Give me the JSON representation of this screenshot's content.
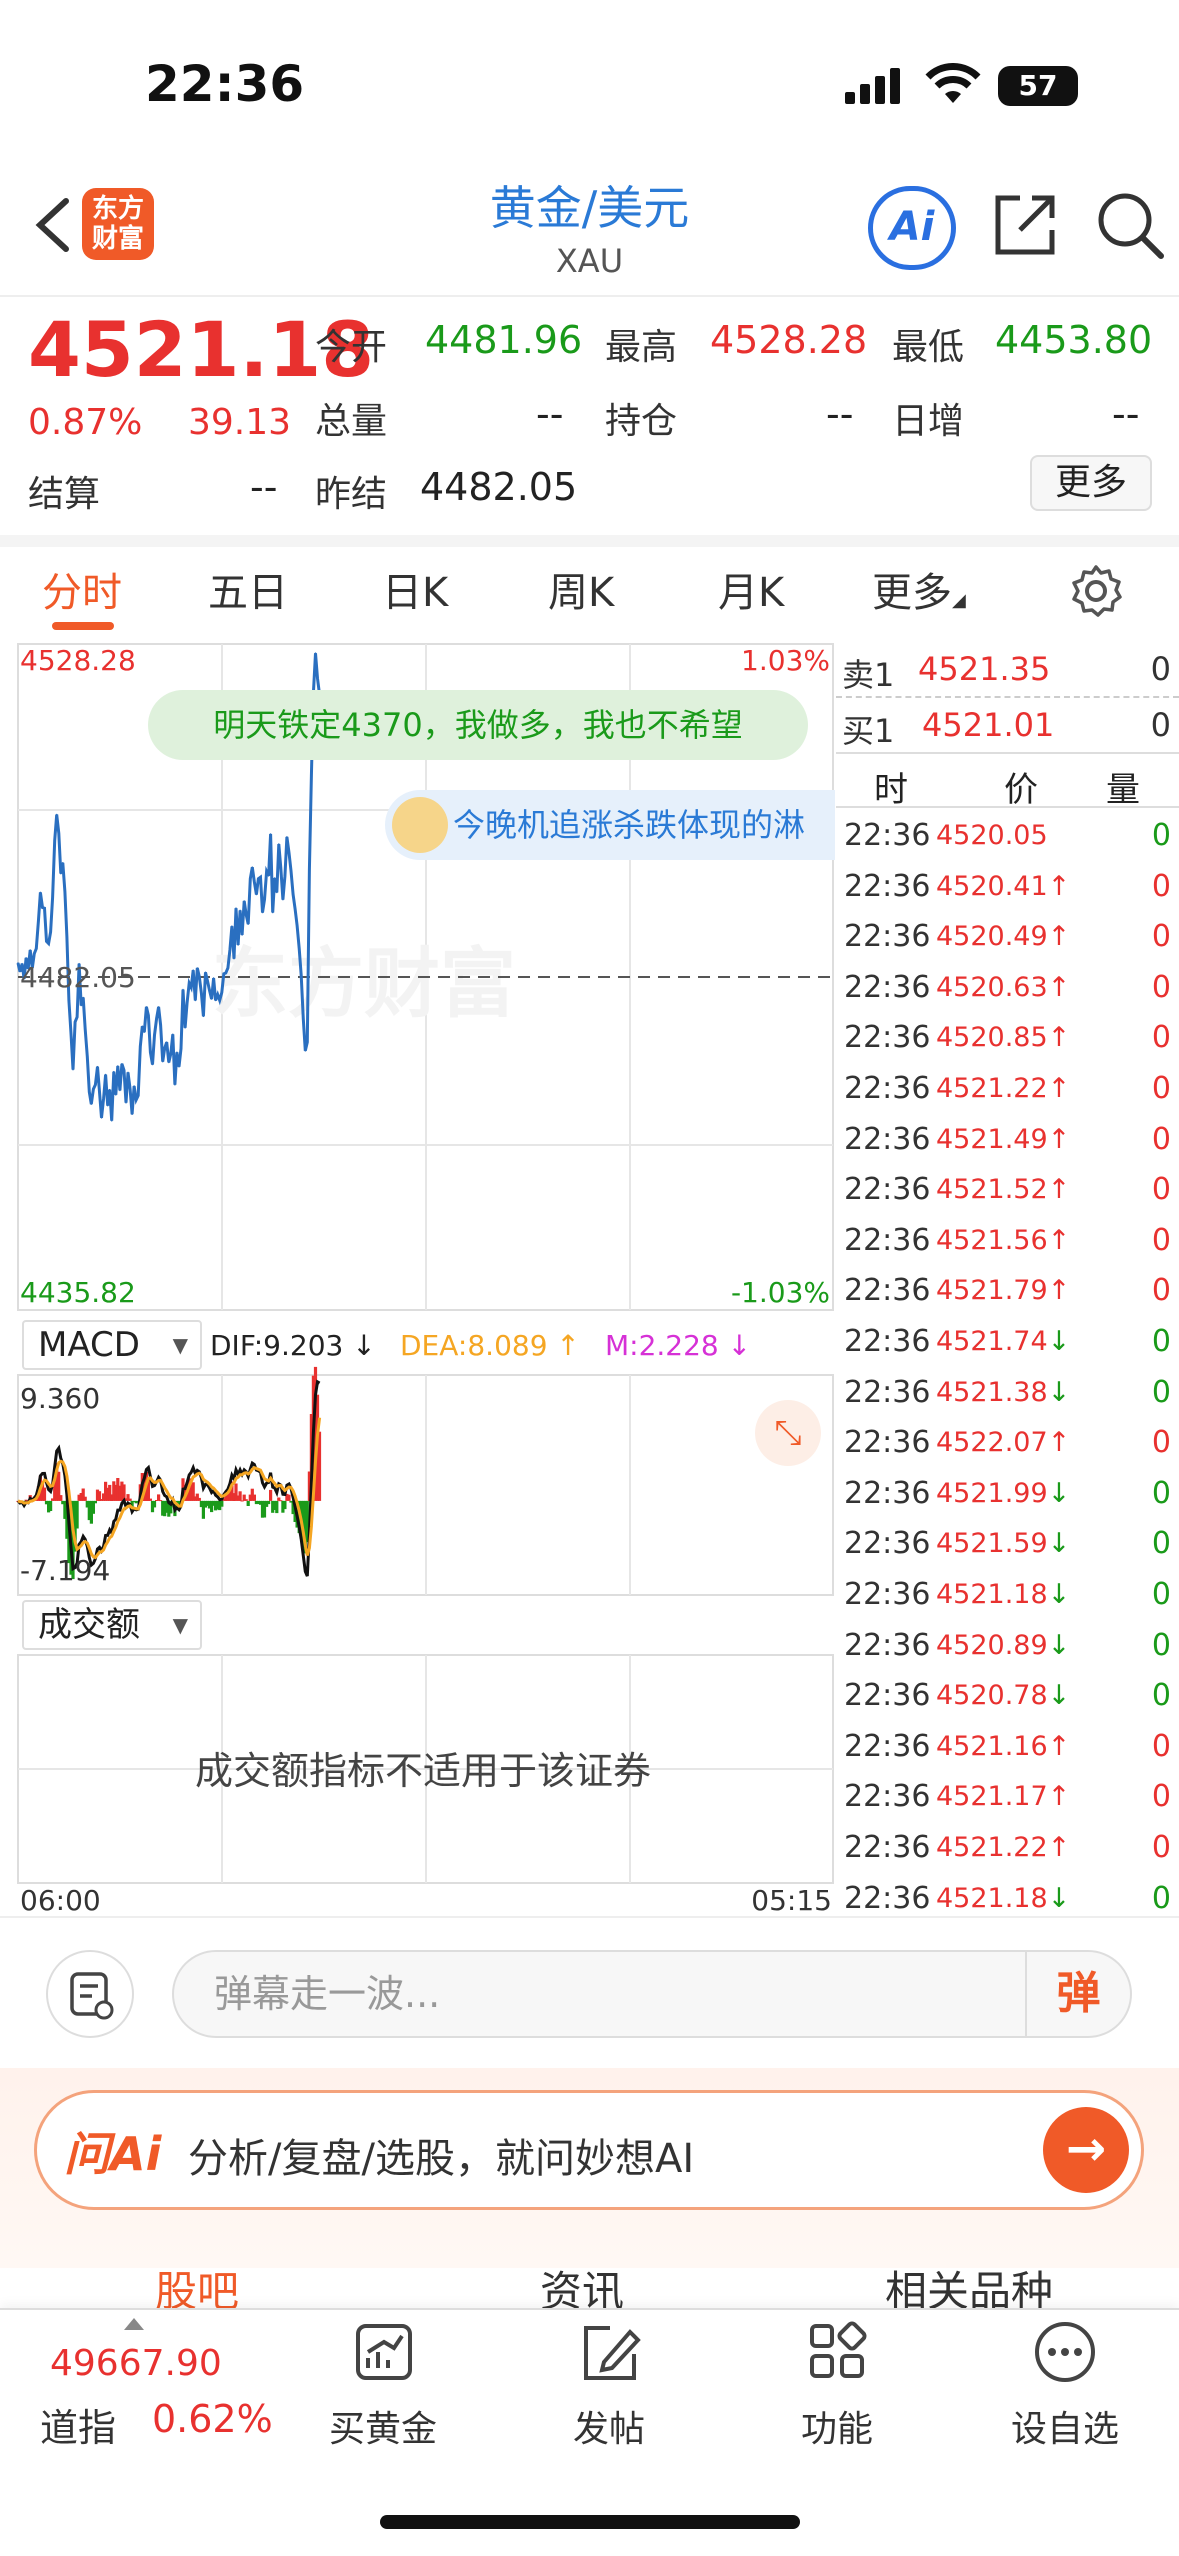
{
  "status_bar": {
    "time": "22:36",
    "battery": "57"
  },
  "header": {
    "logo_text_line1": "东方",
    "logo_text_line2": "财富",
    "title": "黄金/美元",
    "subtitle": "XAU",
    "ai_label": "Ai",
    "icons": [
      "back-icon",
      "share-icon",
      "search-icon"
    ]
  },
  "quote": {
    "price": "4521.18",
    "pct_change": "0.87%",
    "change": "39.13",
    "open_label": "今开",
    "open": "4481.96",
    "high_label": "最高",
    "high": "4528.28",
    "low_label": "最低",
    "low": "4453.80",
    "volume_label": "总量",
    "volume": "--",
    "oi_label": "持仓",
    "oi": "--",
    "daily_inc_label": "日增",
    "daily_inc": "--",
    "settle_label": "结算",
    "settle": "--",
    "prev_settle_label": "昨结",
    "prev_settle": "4482.05",
    "more_button": "更多"
  },
  "tabs": [
    "分时",
    "五日",
    "日K",
    "周K",
    "月K",
    "更多"
  ],
  "colors": {
    "accent": "#f05a28",
    "up": "#e8312f",
    "down": "#1a9a1a",
    "line": "#2a6fc0",
    "dea": "#f5a623",
    "m": "#d631d6"
  },
  "chart_data": [
    {
      "type": "line",
      "title": "",
      "y_top_label": "4528.28",
      "y_mid_label": "4482.05",
      "y_bottom_label": "4435.82",
      "pct_top_label": "1.03%",
      "pct_bottom_label": "-1.03%",
      "x_start_label": "06:00",
      "x_end_label": "05:15",
      "ylim": [
        4435.82,
        4528.28
      ],
      "reference": 4482.05,
      "x": [
        0,
        2,
        4,
        6,
        8,
        10,
        12,
        14,
        16,
        18,
        20,
        22,
        24,
        26,
        28,
        30,
        32,
        34,
        36,
        38,
        40,
        42,
        44,
        46,
        48,
        50,
        52,
        54,
        56,
        58,
        60,
        62,
        64,
        66,
        68,
        70,
        72,
        74,
        76,
        78,
        80,
        82,
        84,
        86,
        88,
        90,
        92,
        94,
        96,
        98,
        100,
        102,
        104,
        106,
        108,
        110,
        112,
        114,
        116,
        118,
        120,
        122,
        124,
        126,
        128,
        130,
        132,
        134,
        136,
        138,
        140,
        142,
        144,
        146,
        148,
        150,
        152,
        154,
        156,
        158,
        160,
        162,
        164,
        166,
        168,
        170,
        172,
        174,
        176,
        178,
        180,
        182,
        184,
        186,
        188,
        190,
        192,
        194,
        196,
        198,
        200,
        202,
        204,
        206,
        208,
        210,
        212,
        214,
        216,
        218,
        220,
        222,
        224,
        226,
        228,
        230,
        232,
        234,
        236,
        238,
        240,
        242,
        244,
        246,
        248,
        250,
        252,
        254,
        256,
        258,
        260,
        262,
        264,
        266,
        268,
        270,
        272,
        274,
        276,
        278,
        280,
        282,
        284,
        286,
        288,
        290,
        292,
        294,
        296,
        298,
        300,
        302,
        304,
        306,
        308,
        310,
        312,
        314,
        316,
        318,
        320,
        322,
        324,
        326,
        328,
        330,
        332,
        334,
        336,
        338,
        340,
        342,
        344,
        346,
        348,
        350,
        352,
        354,
        356,
        358,
        360,
        362,
        364,
        366,
        368,
        370,
        372,
        374,
        376,
        378,
        380,
        382,
        384,
        386
      ],
      "series": [
        {
          "values": [
            4484.0,
            4482.8,
            4483.9,
            4481.8,
            4484.7,
            4483.2,
            4485.8,
            4483.3,
            4485.3,
            4486.0,
            4489.8,
            4493.8,
            4491.7,
            4491.6,
            4487.0,
            4486.7,
            4488.3,
            4493.1,
            4501.0,
            4504.6,
            4502.0,
            4496.4,
            4497.9,
            4493.9,
            4487.6,
            4478.8,
            4474.2,
            4469.2,
            4475.8,
            4476.5,
            4483.9,
            4478.1,
            4479.2,
            4474.8,
            4471.0,
            4466.1,
            4464.4,
            4466.5,
            4467.1,
            4469.6,
            4466.1,
            4462.5,
            4465.2,
            4468.5,
            4464.2,
            4466.4,
            4462.1,
            4468.9,
            4465.7,
            4469.7,
            4466.3,
            4470.0,
            4469.1,
            4464.6,
            4468.8,
            4466.5,
            4463.0,
            4466.9,
            4465.0,
            4465.6,
            4472.4,
            4475.2,
            4474.4,
            4477.9,
            4476.7,
            4471.6,
            4469.9,
            4474.0,
            4476.3,
            4477.9,
            4475.4,
            4470.3,
            4472.2,
            4473.0,
            4470.2,
            4471.4,
            4474.1,
            4467.1,
            4471.6,
            4469.6,
            4472.1,
            4480.3,
            4475.0,
            4478.5,
            4481.2,
            4480.6,
            4483.0,
            4478.8,
            4483.3,
            4482.1,
            4479.8,
            4476.6,
            4482.7,
            4481.5,
            4480.2,
            4479.0,
            4481.9,
            4478.8,
            4479.6,
            4478.8,
            4479.9,
            4482.5,
            4482.6,
            4483.3,
            4485.8,
            4489.1,
            4484.6,
            4491.6,
            4486.5,
            4491.3,
            4487.9,
            4492.6,
            4490.7,
            4489.4,
            4495.7,
            4497.3,
            4495.3,
            4493.5,
            4495.7,
            4495.9,
            4491.0,
            4492.8,
            4496.7,
            4496.1,
            4501.9,
            4491.0,
            4495.8,
            4493.8,
            4500.5,
            4497.2,
            4492.8,
            4496.0,
            4501.5,
            4499.3,
            4496.8,
            4493.5,
            4491.5,
            4489.2,
            4486.0,
            4482.3,
            4476.2,
            4471.8,
            4473.0,
            4497.0,
            4510.0,
            4521.5,
            4527.0,
            4523.5,
            4521.2
          ]
        }
      ]
    },
    {
      "type": "bar",
      "title": "",
      "indicator": "MACD",
      "dif_label": "DIF:9.203 ↓",
      "dea_label": "DEA:8.089 ↑",
      "m_label": "M:2.228 ↓",
      "y_top_label": "9.360",
      "y_bottom_label": "-7.194",
      "ylim": [
        -7.194,
        9.36
      ]
    }
  ],
  "indicator_selectors": {
    "macd": "MACD",
    "volume": "成交额"
  },
  "volume_message": "成交额指标不适用于该证券",
  "danmaku": [
    {
      "text": "明天铁定4370，我做多，我也不希望"
    },
    {
      "text": "今晚机追涨杀跌体现的淋"
    }
  ],
  "order_book": [
    {
      "label": "卖1",
      "price": "4521.35",
      "qty": "0"
    },
    {
      "label": "买1",
      "price": "4521.01",
      "qty": "0"
    }
  ],
  "ticks_header": {
    "time": "时",
    "price": "价",
    "qty": "量"
  },
  "ticks": [
    {
      "time": "22:36",
      "price": "4520.05",
      "dir": "",
      "qty": "0",
      "color": "up",
      "qcolor": "down"
    },
    {
      "time": "22:36",
      "price": "4520.41",
      "dir": "↑",
      "qty": "0",
      "color": "up",
      "qcolor": "up"
    },
    {
      "time": "22:36",
      "price": "4520.49",
      "dir": "↑",
      "qty": "0",
      "color": "up",
      "qcolor": "up"
    },
    {
      "time": "22:36",
      "price": "4520.63",
      "dir": "↑",
      "qty": "0",
      "color": "up",
      "qcolor": "up"
    },
    {
      "time": "22:36",
      "price": "4520.85",
      "dir": "↑",
      "qty": "0",
      "color": "up",
      "qcolor": "up"
    },
    {
      "time": "22:36",
      "price": "4521.22",
      "dir": "↑",
      "qty": "0",
      "color": "up",
      "qcolor": "up"
    },
    {
      "time": "22:36",
      "price": "4521.49",
      "dir": "↑",
      "qty": "0",
      "color": "up",
      "qcolor": "up"
    },
    {
      "time": "22:36",
      "price": "4521.52",
      "dir": "↑",
      "qty": "0",
      "color": "up",
      "qcolor": "up"
    },
    {
      "time": "22:36",
      "price": "4521.56",
      "dir": "↑",
      "qty": "0",
      "color": "up",
      "qcolor": "up"
    },
    {
      "time": "22:36",
      "price": "4521.79",
      "dir": "↑",
      "qty": "0",
      "color": "up",
      "qcolor": "up"
    },
    {
      "time": "22:36",
      "price": "4521.74",
      "dir": "↓",
      "qty": "0",
      "color": "up",
      "qcolor": "down"
    },
    {
      "time": "22:36",
      "price": "4521.38",
      "dir": "↓",
      "qty": "0",
      "color": "up",
      "qcolor": "down"
    },
    {
      "time": "22:36",
      "price": "4522.07",
      "dir": "↑",
      "qty": "0",
      "color": "up",
      "qcolor": "up"
    },
    {
      "time": "22:36",
      "price": "4521.99",
      "dir": "↓",
      "qty": "0",
      "color": "up",
      "qcolor": "down"
    },
    {
      "time": "22:36",
      "price": "4521.59",
      "dir": "↓",
      "qty": "0",
      "color": "up",
      "qcolor": "down"
    },
    {
      "time": "22:36",
      "price": "4521.18",
      "dir": "↓",
      "qty": "0",
      "color": "up",
      "qcolor": "down"
    },
    {
      "time": "22:36",
      "price": "4520.89",
      "dir": "↓",
      "qty": "0",
      "color": "up",
      "qcolor": "down"
    },
    {
      "time": "22:36",
      "price": "4520.78",
      "dir": "↓",
      "qty": "0",
      "color": "up",
      "qcolor": "down"
    },
    {
      "time": "22:36",
      "price": "4521.16",
      "dir": "↑",
      "qty": "0",
      "color": "up",
      "qcolor": "up"
    },
    {
      "time": "22:36",
      "price": "4521.17",
      "dir": "↑",
      "qty": "0",
      "color": "up",
      "qcolor": "up"
    },
    {
      "time": "22:36",
      "price": "4521.22",
      "dir": "↑",
      "qty": "0",
      "color": "up",
      "qcolor": "up"
    },
    {
      "time": "22:36",
      "price": "4521.18",
      "dir": "↓",
      "qty": "0",
      "color": "up",
      "qcolor": "down"
    }
  ],
  "comment_bar": {
    "placeholder": "弹幕走一波...",
    "danmaku_button": "弹"
  },
  "ai_banner": {
    "logo": "问Ai",
    "text": "分析/复盘/选股，就问妙想AI",
    "go": "→"
  },
  "sections": [
    "股吧",
    "资讯",
    "相关品种"
  ],
  "bottom_bar": {
    "index_value": "49667.90",
    "index_name": "道指",
    "index_pct": "0.62%",
    "nav": [
      {
        "label": "买黄金",
        "icon": "chart-up-icon"
      },
      {
        "label": "发帖",
        "icon": "edit-icon"
      },
      {
        "label": "功能",
        "icon": "grid-icon"
      },
      {
        "label": "设自选",
        "icon": "more-dots-icon"
      }
    ]
  }
}
